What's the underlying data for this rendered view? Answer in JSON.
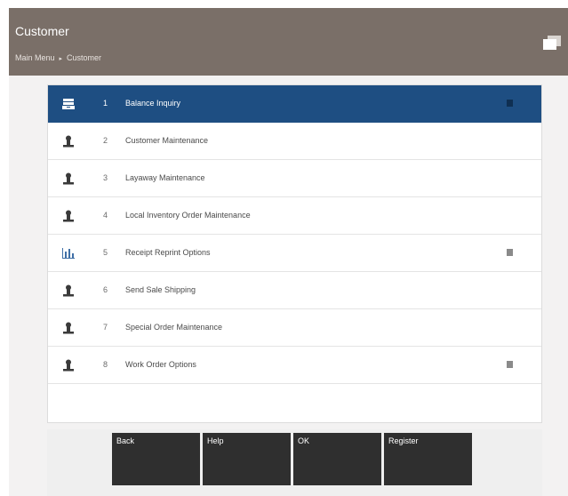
{
  "header": {
    "title": "Customer",
    "breadcrumb": [
      "Main Menu",
      "Customer"
    ],
    "breadcrumb_separator": "▸"
  },
  "menu": {
    "selected_index": 0,
    "items": [
      {
        "number": "1",
        "label": "Balance Inquiry",
        "icon": "register-icon",
        "doc": true
      },
      {
        "number": "2",
        "label": "Customer Maintenance",
        "icon": "person-icon",
        "doc": false
      },
      {
        "number": "3",
        "label": "Layaway Maintenance",
        "icon": "person-icon",
        "doc": false
      },
      {
        "number": "4",
        "label": "Local Inventory Order Maintenance",
        "icon": "person-icon",
        "doc": false
      },
      {
        "number": "5",
        "label": "Receipt Reprint Options",
        "icon": "bar-chart-icon",
        "doc": true
      },
      {
        "number": "6",
        "label": "Send Sale Shipping",
        "icon": "person-icon",
        "doc": false
      },
      {
        "number": "7",
        "label": "Special Order Maintenance",
        "icon": "person-icon",
        "doc": false
      },
      {
        "number": "8",
        "label": "Work Order Options",
        "icon": "person-icon",
        "doc": true
      }
    ]
  },
  "buttons": {
    "back": "Back",
    "help": "Help",
    "ok": "OK",
    "register": "Register"
  },
  "colors": {
    "header": "#7a6f68",
    "selected_row": "#1e4e82",
    "button": "#2f2f2f"
  }
}
